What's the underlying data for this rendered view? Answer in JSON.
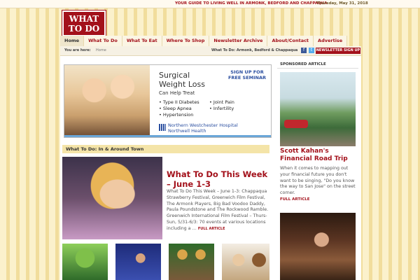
{
  "header": {
    "tagline": "YOUR GUIDE TO LIVING WELL IN ARMONK, BEDFORD AND CHAPPAQUA",
    "separator": "|",
    "date": "Thursday, May 31, 2018",
    "logo_line1": "WHAT",
    "logo_line2": "TO DO"
  },
  "nav": {
    "tabs": [
      {
        "label": "Home"
      },
      {
        "label": "What To Do"
      },
      {
        "label": "What To Eat"
      },
      {
        "label": "Where To Shop"
      },
      {
        "label": "Newsletter Archive"
      },
      {
        "label": "About/Contact"
      },
      {
        "label": "Advertise"
      }
    ]
  },
  "subbar": {
    "you_are_here": "You are here:",
    "crumb": "Home",
    "location": "What To Do: Armonk, Bedford & Chappaqua",
    "facebook": "f",
    "twitter": "t",
    "newsletter_button": "NEWSLETTER SIGN UP"
  },
  "ad": {
    "headline1": "Surgical",
    "headline2": "Weight Loss",
    "sub": "Can Help Treat",
    "list1": [
      "• Type II Diabetes",
      "• Sleep Apnea",
      "• Hypertension"
    ],
    "list2": [
      "• Joint Pain",
      "• Infertility"
    ],
    "seminar": "SIGN UP FOR FREE SEMINAR",
    "hospital1": "Northern Westchester Hospital",
    "hospital2": "Northwell Health"
  },
  "section": {
    "title": "What To Do: In & Around Town"
  },
  "feature": {
    "title": "What To Do This Week – June 1-3",
    "body": "What To Do This Week – June 1-3: Chappaqua Strawberry Festival, Greenwich Film Festival, The Armonk Players, Big Bad Voodoo Daddy, Paula Poundstone and The Rockwood Ramble. Greenwich International Film Festival – Thurs-Sun, 5/31-6/3: 70 events at various locations including a …",
    "more": "FULL ARTICLE"
  },
  "sidebar": {
    "label": "SPONSORED ARTICLE",
    "article_title": "Scott Kahan's Financial Road Trip",
    "article_body": "When it comes to mapping out your financial future you don't want to be singing, \"Do you know the way to San Jose\" on the street corner.",
    "more": "FULL ARTICLE"
  }
}
